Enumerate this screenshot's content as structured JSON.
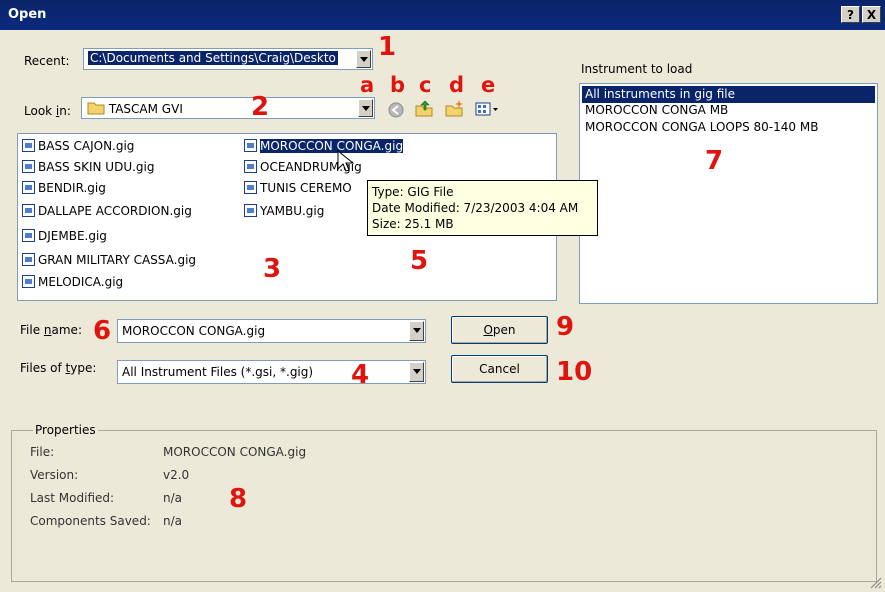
{
  "window": {
    "title": "Open",
    "help_btn": "?",
    "close_btn": "X"
  },
  "recent": {
    "label": "Recent:",
    "value": "C:\\Documents and Settings\\Craig\\Deskto"
  },
  "lookin": {
    "label_pre": "Look ",
    "label_ul": "i",
    "label_post": "n:",
    "value": "TASCAM GVI"
  },
  "toolbar": {
    "tools": [
      {
        "letter": "a",
        "icon": "back-icon"
      },
      {
        "letter": "b",
        "icon": "up-folder-icon"
      },
      {
        "letter": "c",
        "icon": "new-folder-icon"
      },
      {
        "letter": "d",
        "icon": "view-menu-icon"
      },
      {
        "letter": "e",
        "icon": "view-options-icon"
      }
    ]
  },
  "files": {
    "col1": [
      "BASS CAJON.gig",
      "BASS SKIN UDU.gig",
      "BENDIR.gig",
      "DALLAPE ACCORDION.gig",
      "DJEMBE.gig",
      "GRAN MILITARY CASSA.gig",
      "MELODICA.gig"
    ],
    "col2": [
      "MOROCCON CONGA.gig",
      "OCEANDRUM.gig",
      "TUNIS CEREMO",
      "YAMBU.gig"
    ],
    "selected": "MOROCCON CONGA.gig"
  },
  "tooltip": {
    "type": "Type: GIG File",
    "date": "Date Modified: 7/23/2003 4:04 AM",
    "size": "Size: 25.1 MB"
  },
  "instruments": {
    "label": "Instrument to load",
    "items": [
      "All instruments in gig file",
      "MOROCCON CONGA  MB",
      "MOROCCON CONGA LOOPS 80-140  MB"
    ]
  },
  "filename": {
    "label_pre": "File ",
    "label_ul": "n",
    "label_post": "ame:",
    "value": "MOROCCON CONGA.gig"
  },
  "filetype": {
    "label_pre": "Files of ",
    "label_ul": "t",
    "label_post": "ype:",
    "value": "All Instrument Files (*.gsi, *.gig)"
  },
  "buttons": {
    "open_ul": "O",
    "open_rest": "pen",
    "cancel": "Cancel"
  },
  "properties": {
    "title": "Properties",
    "rows": [
      {
        "key": "File:",
        "value": "MOROCCON CONGA.gig"
      },
      {
        "key": "Version:",
        "value": "v2.0"
      },
      {
        "key": "Last Modified:",
        "value": "n/a"
      },
      {
        "key": "Components Saved:",
        "value": "n/a"
      }
    ]
  },
  "markers": [
    "1",
    "2",
    "3",
    "4",
    "5",
    "6",
    "7",
    "8",
    "9",
    "10"
  ]
}
